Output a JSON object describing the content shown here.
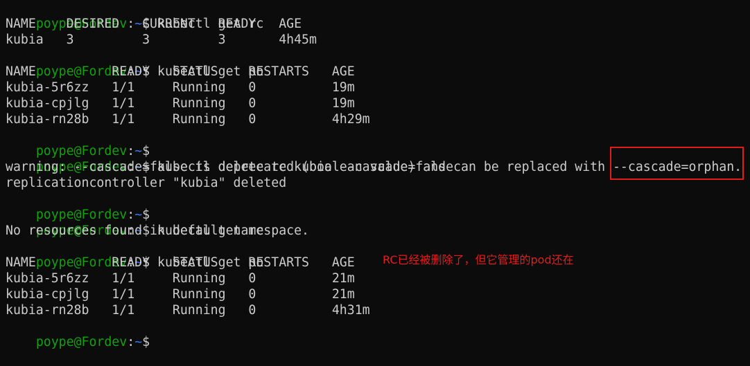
{
  "colors": {
    "background": "#0c0c0c",
    "text": "#cccccc",
    "prompt_user": "#13a10e",
    "prompt_path": "#3b78ff",
    "annotation": "#e81c1c",
    "highlight_box": "#e21b1b"
  },
  "prompt": {
    "user": "poype@Fordev",
    "sep": ":",
    "path": "~",
    "symbol": "$"
  },
  "lines": [
    {
      "type": "prompt",
      "cmd": " kubectl get rc"
    },
    {
      "type": "output",
      "text": "NAME    DESIRED   CURRENT   READY   AGE"
    },
    {
      "type": "output",
      "text": "kubia   3         3         3       4h45m"
    },
    {
      "type": "prompt",
      "cmd": " kubectl get po"
    },
    {
      "type": "output",
      "text": "NAME          READY   STATUS    RESTARTS   AGE"
    },
    {
      "type": "output",
      "text": "kubia-5r6zz   1/1     Running   0          19m"
    },
    {
      "type": "output",
      "text": "kubia-cpjlg   1/1     Running   0          19m"
    },
    {
      "type": "output",
      "text": "kubia-rn28b   1/1     Running   0          4h29m"
    },
    {
      "type": "prompt",
      "cmd": ""
    },
    {
      "type": "prompt",
      "cmd": " kubectl delete rc kubia --cascade=false"
    },
    {
      "type": "output",
      "text": "warning: --cascade=false is deprecated (boolean value) and can be replaced with --cascade=orphan."
    },
    {
      "type": "output",
      "text": "replicationcontroller \"kubia\" deleted"
    },
    {
      "type": "prompt",
      "cmd": ""
    },
    {
      "type": "prompt",
      "cmd": " kubectl get rc"
    },
    {
      "type": "output",
      "text": "No resources found in default namespace."
    },
    {
      "type": "prompt",
      "cmd": " kubectl get po"
    },
    {
      "type": "output",
      "text": "NAME          READY   STATUS    RESTARTS   AGE"
    },
    {
      "type": "output",
      "text": "kubia-5r6zz   1/1     Running   0          21m"
    },
    {
      "type": "output",
      "text": "kubia-cpjlg   1/1     Running   0          21m"
    },
    {
      "type": "output",
      "text": "kubia-rn28b   1/1     Running   0          4h31m"
    },
    {
      "type": "prompt",
      "cmd": ""
    }
  ],
  "annotation": {
    "text": "RC已经被删除了，但它管理的pod还在"
  }
}
